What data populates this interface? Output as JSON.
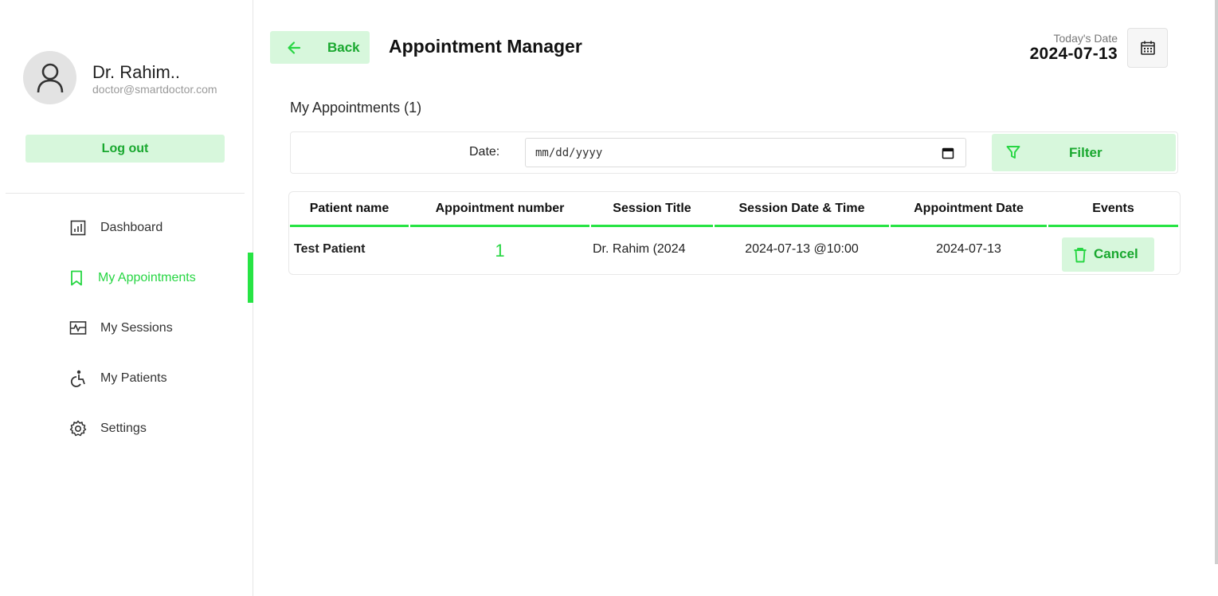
{
  "profile": {
    "name": "Dr. Rahim..",
    "email": "doctor@smartdoctor.com",
    "logout_label": "Log out"
  },
  "nav": {
    "items": [
      {
        "label": "Dashboard",
        "icon": "dashboard-icon"
      },
      {
        "label": "My Appointments",
        "icon": "bookmark-icon",
        "active": true
      },
      {
        "label": "My Sessions",
        "icon": "sessions-icon"
      },
      {
        "label": "My Patients",
        "icon": "patient-icon"
      },
      {
        "label": "Settings",
        "icon": "gear-icon"
      }
    ]
  },
  "header": {
    "back_label": "Back",
    "title": "Appointment Manager",
    "today_label": "Today's Date",
    "today_value": "2024-07-13"
  },
  "appointments": {
    "section_title": "My Appointments (1)",
    "filter": {
      "date_label": "Date:",
      "date_placeholder": "mm/dd/yyyy",
      "filter_label": "Filter"
    },
    "columns": [
      "Patient name",
      "Appointment number",
      "Session Title",
      "Session Date & Time",
      "Appointment Date",
      "Events"
    ],
    "rows": [
      {
        "patient_name": "Test Patient",
        "appointment_number": "1",
        "session_title": "Dr. Rahim (2024",
        "session_datetime": "2024-07-13 @10:00",
        "appointment_date": "2024-07-13",
        "action_label": "Cancel"
      }
    ]
  },
  "colors": {
    "accent": "#27e444",
    "accent_text": "#19a82f",
    "button_bg": "#d7f7dc"
  }
}
